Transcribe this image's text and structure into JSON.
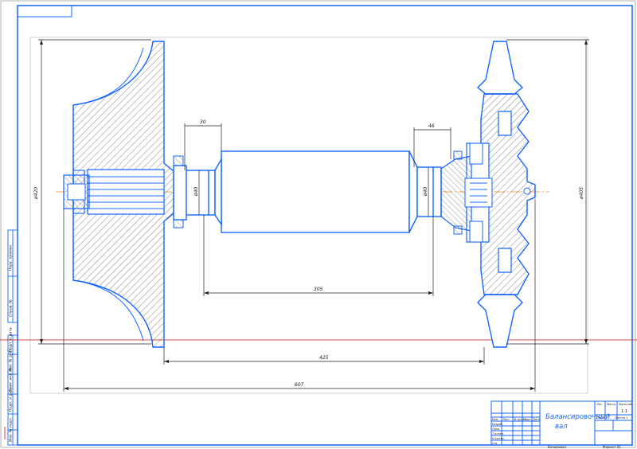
{
  "colors": {
    "outline": "#1565ff",
    "hatch": "#333333",
    "dim": "#222222",
    "frame": "#1565ff",
    "axis": "#f08a24",
    "red_line": "#cc1111",
    "sheet_border": "#b0b0b0"
  },
  "dimensions": {
    "dia_left": "ø420",
    "dia_right": "ø405",
    "journal_left": "ø40",
    "journal_right": "ø40",
    "step_left": "30",
    "step_right": "46",
    "inner_span": "305",
    "mid_span": "425",
    "overall": "607"
  },
  "title_block": {
    "name_line1": "Балансировочный",
    "name_line2": "вал",
    "row_labels": [
      "Изм",
      "Лист",
      "№ докум.",
      "Подп.",
      "Дата"
    ],
    "role_labels": [
      "Разраб.",
      "Пров.",
      "Т.контр.",
      "Н.контр.",
      "Утв."
    ],
    "col_labels": [
      "Лит.",
      "Масса",
      "Масштаб"
    ],
    "scale": "1:1",
    "sheet_label": "Лист",
    "sheets_label": "Листов 1",
    "copied": "Копировал",
    "format": "Формат A1"
  },
  "side_stamp": {
    "cells": [
      "Подп. и дата",
      "Инв. № дубл.",
      "Взам. инв. №",
      "Подп. и дата",
      "Инв. № подл."
    ],
    "top_cells": [
      "Перв. примен.",
      "Справ. №"
    ]
  }
}
